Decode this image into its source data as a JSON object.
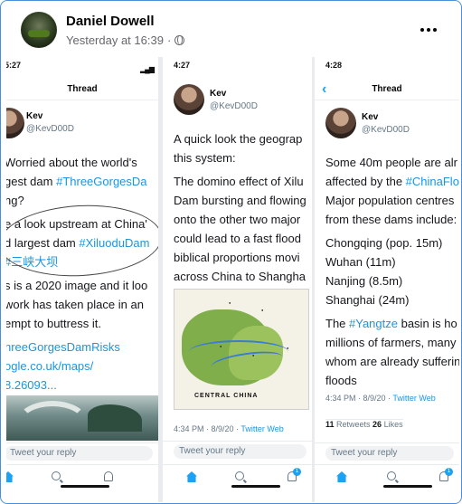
{
  "post": {
    "author": "Daniel Dowell",
    "timestamp": "Yesterday at 16:39",
    "separator": "·",
    "privacy_icon": "globe-icon",
    "more_icon": "more-horizontal-icon"
  },
  "panel1": {
    "status_time": "5:27",
    "nav_title": "Thread",
    "user_name": "Kev",
    "user_handle": "@KevD00D",
    "lines": [
      {
        "pre": "Worried about the world's",
        "link": "",
        "post": ""
      },
      {
        "pre": "gest dam ",
        "link": "#ThreeGorgesDa",
        "post": ""
      },
      {
        "pre": "ng?",
        "link": "",
        "post": ""
      },
      {
        "pre": "e a look upstream at China'",
        "link": "",
        "post": ""
      },
      {
        "pre": "d largest dam ",
        "link": "#XiluoduDam",
        "post": ""
      },
      {
        "pre": "",
        "link": "#三峡大坝",
        "post": ""
      },
      {
        "pre": "s is a 2020 image and it loo",
        "link": "",
        "post": ""
      },
      {
        "pre": " work has taken place in an",
        "link": "",
        "post": ""
      },
      {
        "pre": "empt to buttress it.",
        "link": "",
        "post": ""
      }
    ],
    "link_lines": [
      "hreeGorgesDamRisks",
      "ogle.co.uk/maps/",
      "8.26093..."
    ],
    "reply_placeholder": "Tweet your reply"
  },
  "panel2": {
    "status_time": "4:27",
    "user_name": "Kev",
    "user_handle": "@KevD00D",
    "lines": [
      "A quick look the geograp",
      "this system:",
      "The domino effect of Xilu",
      "Dam bursting and flowing",
      "onto the other two major",
      "could lead to a fast flood",
      "biblical proportions movi",
      "across China to Shangha"
    ],
    "map_label": "CENTRAL CHINA",
    "tweet_time": "4:34 PM · 8/9/20 · ",
    "tweet_source": "Twitter Web",
    "reply_placeholder": "Tweet your reply",
    "badge": "1"
  },
  "panel3": {
    "status_time": "4:28",
    "nav_title": "Thread",
    "user_name": "Kev",
    "user_handle": "@KevD00D",
    "lines": [
      {
        "pre": "Some 40m people are alr",
        "link": ""
      },
      {
        "pre": "affected by the ",
        "link": "#ChinaFlo"
      },
      {
        "pre": "Major population centres",
        "link": ""
      },
      {
        "pre": "from these dams include:",
        "link": ""
      }
    ],
    "cities": [
      "Chongqing (pop. 15m)",
      "Wuhan (11m)",
      "Nanjing (8.5m)",
      "Shanghai (24m)"
    ],
    "lines2": [
      {
        "pre": "The ",
        "link": "#Yangtze",
        "post": " basin is ho"
      },
      {
        "pre": "millions of farmers, many",
        "link": "",
        "post": ""
      },
      {
        "pre": "whom are already suffering",
        "link": "",
        "post": ""
      },
      {
        "pre": "floods",
        "link": "",
        "post": ""
      }
    ],
    "tweet_time": "4:34 PM · 8/9/20 · ",
    "tweet_source": "Twitter Web",
    "retweets": "11",
    "retweets_label": " Retweets ",
    "likes": "26",
    "likes_label": " Likes",
    "reply_placeholder": "Tweet your reply",
    "badge": "1"
  }
}
